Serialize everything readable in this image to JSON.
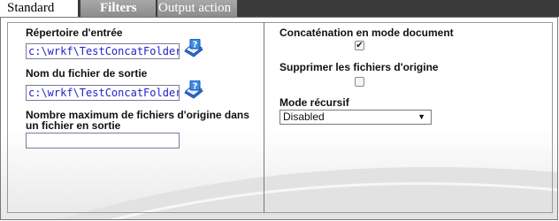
{
  "tabs": {
    "standard": "Standard",
    "filters": "Filters",
    "output_action": "Output action"
  },
  "left": {
    "input_dir_label": "Répertoire d'entrée",
    "input_dir_value": "c:\\wrkf\\TestConcatFolder",
    "output_file_label": "Nom du fichier de sortie",
    "output_file_value": "c:\\wrkf\\TestConcatFolder_S\\f",
    "max_files_label_line1": "Nombre maximum de fichiers d'origine dans",
    "max_files_label_line2": "un fichier en sortie",
    "max_files_value": ""
  },
  "right": {
    "doc_concat_label": "Concaténation en mode document",
    "doc_concat_checked": true,
    "delete_originals_label": "Supprimer les fichiers d'origine",
    "delete_originals_checked": false,
    "recursive_label": "Mode récursif",
    "recursive_value": "Disabled"
  },
  "icons": {
    "help": "help-book-icon",
    "dropdown": "chevron-down-icon",
    "check": "checkmark-icon"
  }
}
